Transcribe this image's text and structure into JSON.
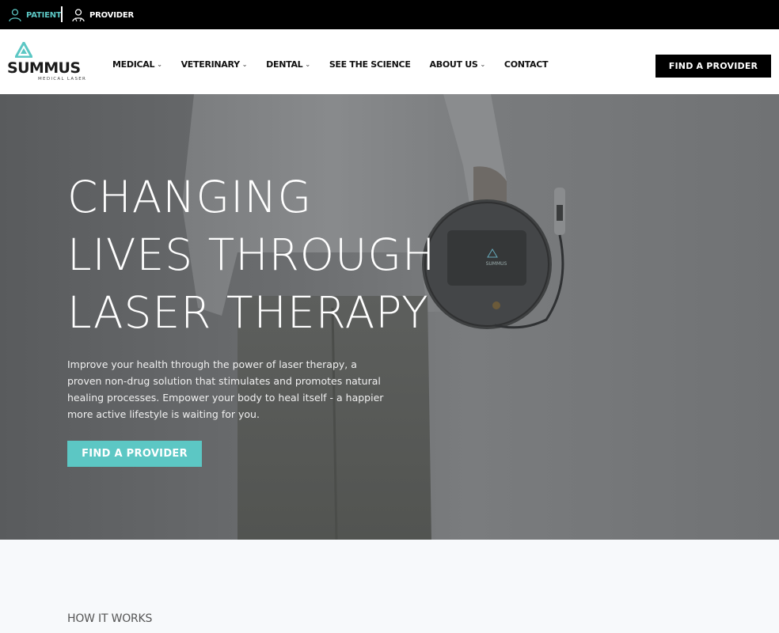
{
  "topbar": {
    "patient_label": "PATIENT",
    "provider_label": "PROVIDER",
    "patient_color": "#5cc7c4",
    "patient_icon": "person-outline-icon",
    "provider_icon": "provider-outline-icon"
  },
  "brand": {
    "name": "SUMMUS",
    "tagline": "MEDICAL LASER",
    "accent": "#5cc7c4"
  },
  "nav": {
    "items": [
      {
        "label": "MEDICAL",
        "has_dropdown": true
      },
      {
        "label": "VETERINARY",
        "has_dropdown": true
      },
      {
        "label": "DENTAL",
        "has_dropdown": true
      },
      {
        "label": "SEE THE SCIENCE",
        "has_dropdown": false
      },
      {
        "label": "ABOUT US",
        "has_dropdown": true
      },
      {
        "label": "CONTACT",
        "has_dropdown": false
      }
    ],
    "cta_label": "FIND A PROVIDER"
  },
  "hero": {
    "title_lines": [
      "CHANGING",
      "LIVES THROUGH",
      "LASER THERAPY"
    ],
    "description": "Improve your health through the power of laser therapy, a proven non-drug solution that stimulates and promotes natural healing processes. Empower your body to heal itself - a happier more active lifestyle is waiting for you.",
    "cta_label": "FIND A PROVIDER",
    "device_label": "SUMMUS"
  },
  "how_it_works": {
    "label": "HOW IT WORKS"
  }
}
